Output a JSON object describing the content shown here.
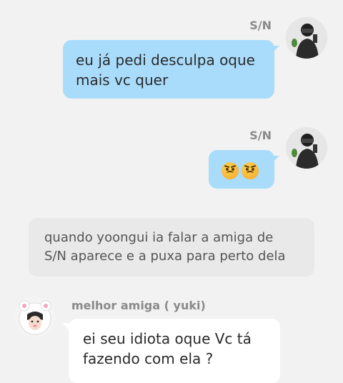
{
  "messages": [
    {
      "side": "right",
      "sender": "S/N",
      "text": "eu já pedi desculpa oque mais vc quer",
      "avatar": "person-dark-shirt-selfie"
    },
    {
      "side": "right",
      "sender": "S/N",
      "emojis": [
        "pouting-face-emoji",
        "pouting-face-emoji"
      ],
      "avatar": "person-dark-shirt-selfie"
    },
    {
      "type": "narration",
      "text": "quando yoongui ia falar a amiga de S/N aparece e a puxa para perto dela"
    },
    {
      "side": "left",
      "sender": "melhor amiga ( yuki)",
      "text": "ei seu idiota oque Vc tá fazendo com ela ?",
      "avatar": "girl-pink-bear-hood"
    }
  ],
  "colors": {
    "background": "#f2f2f2",
    "my_bubble": "#a9dcfb",
    "their_bubble": "#ffffff",
    "narration_bg": "#e9e9e9",
    "name_text": "#8a8a8a"
  }
}
